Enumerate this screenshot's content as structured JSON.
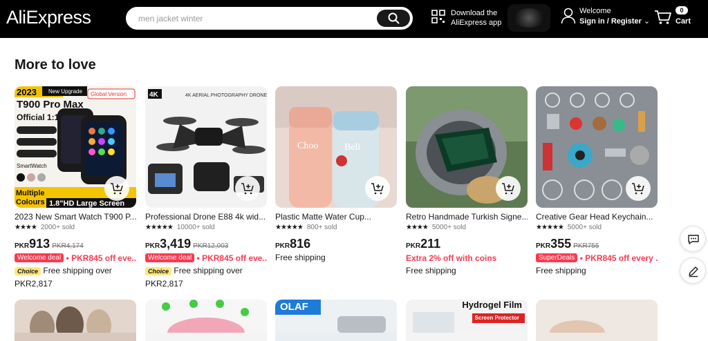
{
  "header": {
    "logo": "AliExpress",
    "search_placeholder": "men jacket winter",
    "download_line1": "Download the",
    "download_line2": "AliExpress app",
    "welcome": "Welcome",
    "signin": "Sign in / Register",
    "cart_count": "0",
    "cart_label": "Cart"
  },
  "section": {
    "title": "More to love"
  },
  "products": [
    {
      "name": "2023 New Smart Watch T900 P...",
      "rating_stars": "★★★★",
      "sold": "2000+ sold",
      "currency": "PKR",
      "price": "913",
      "original": "PKR4,174",
      "badge": "Welcome deal",
      "promo": "• PKR845 off eve...",
      "choice": "Choice",
      "shipping": "Free shipping over",
      "extra": "PKR2,817"
    },
    {
      "name": "Professional Drone E88 4k wid...",
      "rating_stars": "★★★★★",
      "sold": "10000+ sold",
      "currency": "PKR",
      "price": "3,419",
      "original": "PKR12,003",
      "badge": "Welcome deal",
      "promo": "• PKR845 off eve...",
      "choice": "Choice",
      "shipping": "Free shipping over",
      "extra": "PKR2,817"
    },
    {
      "name": "Plastic Matte Water Cup...",
      "rating_stars": "★★★★★",
      "sold": "800+ sold",
      "currency": "PKR",
      "price": "816",
      "original": "",
      "shipping": "Free shipping"
    },
    {
      "name": "Retro Handmade Turkish Signe...",
      "rating_stars": "★★★★",
      "sold": "5000+ sold",
      "currency": "PKR",
      "price": "211",
      "original": "",
      "promo": "Extra 2% off with coins",
      "shipping": "Free shipping"
    },
    {
      "name": "Creative Gear Head Keychain...",
      "rating_stars": "★★★★★",
      "sold": "5000+ sold",
      "currency": "PKR",
      "price": "355",
      "original": "PKR755",
      "badge": "SuperDeals",
      "promo": "• PKR845 off every ...",
      "shipping": "Free shipping"
    }
  ],
  "row2": [
    {
      "label": ""
    },
    {
      "label": ""
    },
    {
      "label": "OLAF"
    },
    {
      "label": "Hydrogel Film",
      "sublabel": "Screen Protector"
    },
    {
      "label": ""
    }
  ],
  "colors": {
    "accent": "#fd384f",
    "header_bg": "#000000",
    "choice": "#ffe680"
  }
}
